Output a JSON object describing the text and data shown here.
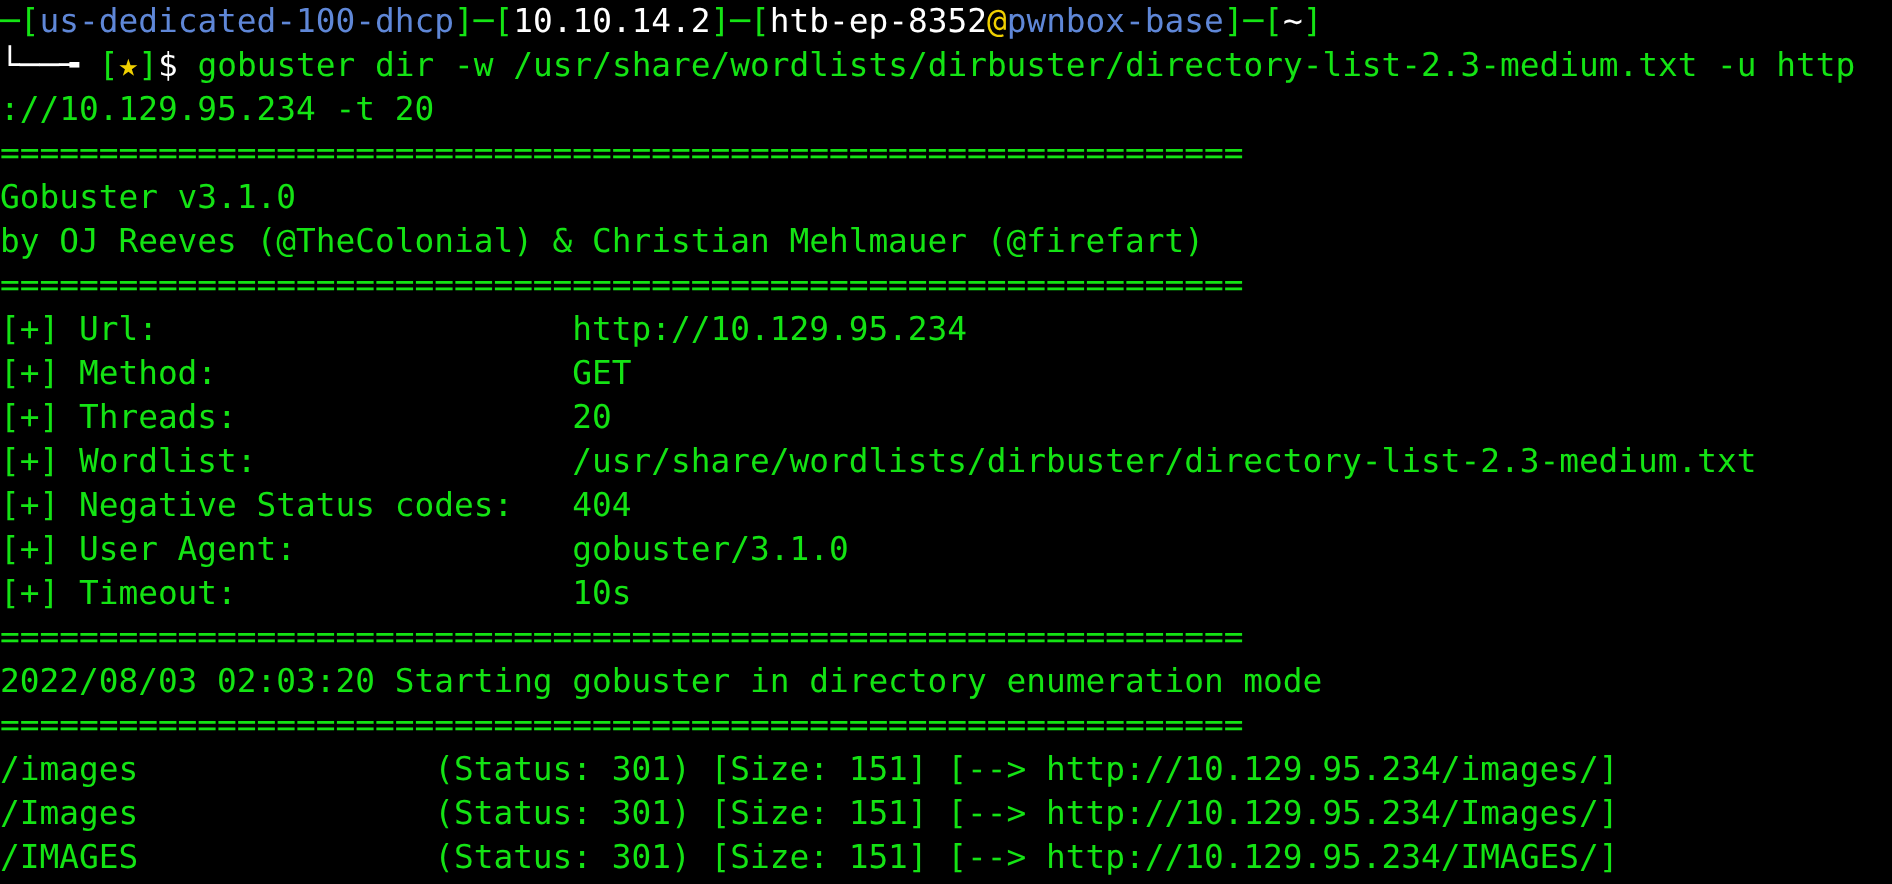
{
  "prompt": {
    "segments": [
      {
        "text": "─[",
        "color": "#14e314"
      },
      {
        "text": "us-dedicated-100-dhcp",
        "color": "#5f87d7"
      },
      {
        "text": "]─[",
        "color": "#14e314"
      },
      {
        "text": "10.10.14.2",
        "color": "#ffffff"
      },
      {
        "text": "]─[",
        "color": "#14e314"
      },
      {
        "text": "htb-ep-8352",
        "color": "#ffffff"
      },
      {
        "text": "@",
        "color": "#f0d000"
      },
      {
        "text": "pwnbox-base",
        "color": "#5f87d7"
      },
      {
        "text": "]─[",
        "color": "#14e314"
      },
      {
        "text": "~",
        "color": "#ffffff"
      },
      {
        "text": "]",
        "color": "#14e314"
      }
    ],
    "marker": [
      {
        "text": "└──╼ ",
        "color": "#ffffff"
      },
      {
        "text": "[",
        "color": "#14e314"
      },
      {
        "text": "★",
        "color": "#f0d000"
      },
      {
        "text": "]",
        "color": "#14e314"
      },
      {
        "text": "$ ",
        "color": "#ffffff"
      }
    ],
    "command": [
      "gobuster dir -w /usr/share/wordlists/dirbuster/directory-list-2.3-medium.txt -u http",
      "://10.129.95.234 -t 20"
    ]
  },
  "lines": [
    {
      "kind": "separator",
      "text": "==============================================================="
    },
    {
      "kind": "text",
      "text": "Gobuster v3.1.0"
    },
    {
      "kind": "text",
      "text": "by OJ Reeves (@TheColonial) & Christian Mehlmauer (@firefart)"
    },
    {
      "kind": "separator",
      "text": "==============================================================="
    },
    {
      "kind": "setting",
      "label": "[+] Url:",
      "value": "http://10.129.95.234"
    },
    {
      "kind": "setting",
      "label": "[+] Method:",
      "value": "GET"
    },
    {
      "kind": "setting",
      "label": "[+] Threads:",
      "value": "20"
    },
    {
      "kind": "setting",
      "label": "[+] Wordlist:",
      "value": "/usr/share/wordlists/dirbuster/directory-list-2.3-medium.txt"
    },
    {
      "kind": "setting",
      "label": "[+] Negative Status codes:",
      "value": "404"
    },
    {
      "kind": "setting",
      "label": "[+] User Agent:",
      "value": "gobuster/3.1.0"
    },
    {
      "kind": "setting",
      "label": "[+] Timeout:",
      "value": "10s"
    },
    {
      "kind": "separator",
      "text": "==============================================================="
    },
    {
      "kind": "text",
      "text": "2022/08/03 02:03:20 Starting gobuster in directory enumeration mode"
    },
    {
      "kind": "separator",
      "text": "==============================================================="
    },
    {
      "kind": "result",
      "path": "/images",
      "status": "(Status: 301)",
      "size": "[Size: 151]",
      "redirect": "[--> http://10.129.95.234/images/]"
    },
    {
      "kind": "result",
      "path": "/Images",
      "status": "(Status: 301)",
      "size": "[Size: 151]",
      "redirect": "[--> http://10.129.95.234/Images/]"
    },
    {
      "kind": "result",
      "path": "/IMAGES",
      "status": "(Status: 301)",
      "size": "[Size: 151]",
      "redirect": "[--> http://10.129.95.234/IMAGES/]"
    }
  ]
}
